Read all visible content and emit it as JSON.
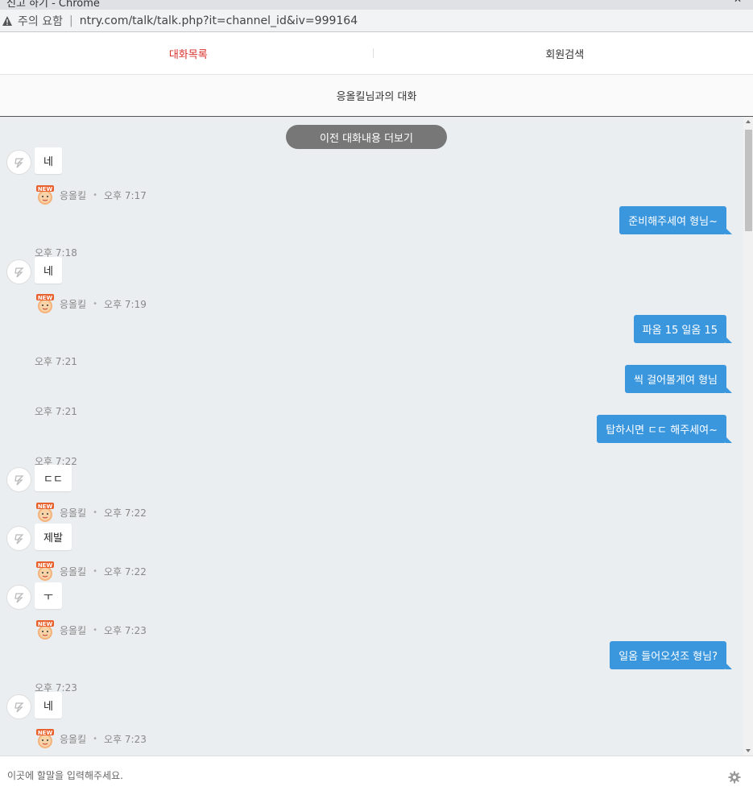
{
  "browser": {
    "window_title": "신고 하기 - Chrome",
    "security_label": "주의 요함",
    "url": "ntry.com/talk/talk.php?it=channel_id&iv=999164"
  },
  "tabs": [
    {
      "label": "대화목록",
      "active": true
    },
    {
      "label": "회원검색",
      "active": false
    }
  ],
  "conversation_title": "응올킬님과의 대화",
  "load_more_label": "이전 대화내용 더보기",
  "other_user": {
    "name": "응올킬",
    "badge": "NEW"
  },
  "messages": [
    {
      "type": "in",
      "text": "네",
      "time": "오후 7:17"
    },
    {
      "type": "out",
      "text": "준비해주세여 형님~",
      "time": "오후 7:18"
    },
    {
      "type": "in",
      "text": "네",
      "time": "오후 7:19"
    },
    {
      "type": "out",
      "text": "파옴 15 일옴 15",
      "time": "오후 7:21"
    },
    {
      "type": "out",
      "text": "씩 걸어볼게여 형님",
      "time": "오후 7:21"
    },
    {
      "type": "out",
      "text": "탑하시면 ㄷㄷ 해주세여~",
      "time": "오후 7:22"
    },
    {
      "type": "in",
      "text": "ㄷㄷ",
      "time": "오후 7:22"
    },
    {
      "type": "in",
      "text": "제발",
      "time": "오후 7:22"
    },
    {
      "type": "in",
      "text": "ㅜ",
      "time": "오후 7:23"
    },
    {
      "type": "out",
      "text": "일옴 들어오셧조 형님?",
      "time": "오후 7:23"
    },
    {
      "type": "in",
      "text": "네",
      "time": "오후 7:23"
    }
  ],
  "input": {
    "placeholder": "이곳에 할말을 입력해주세요.",
    "value": ""
  },
  "colors": {
    "accent_tab": "#d9302c",
    "bubble_out": "#3a96dd",
    "chat_bg": "#ebeef0"
  }
}
